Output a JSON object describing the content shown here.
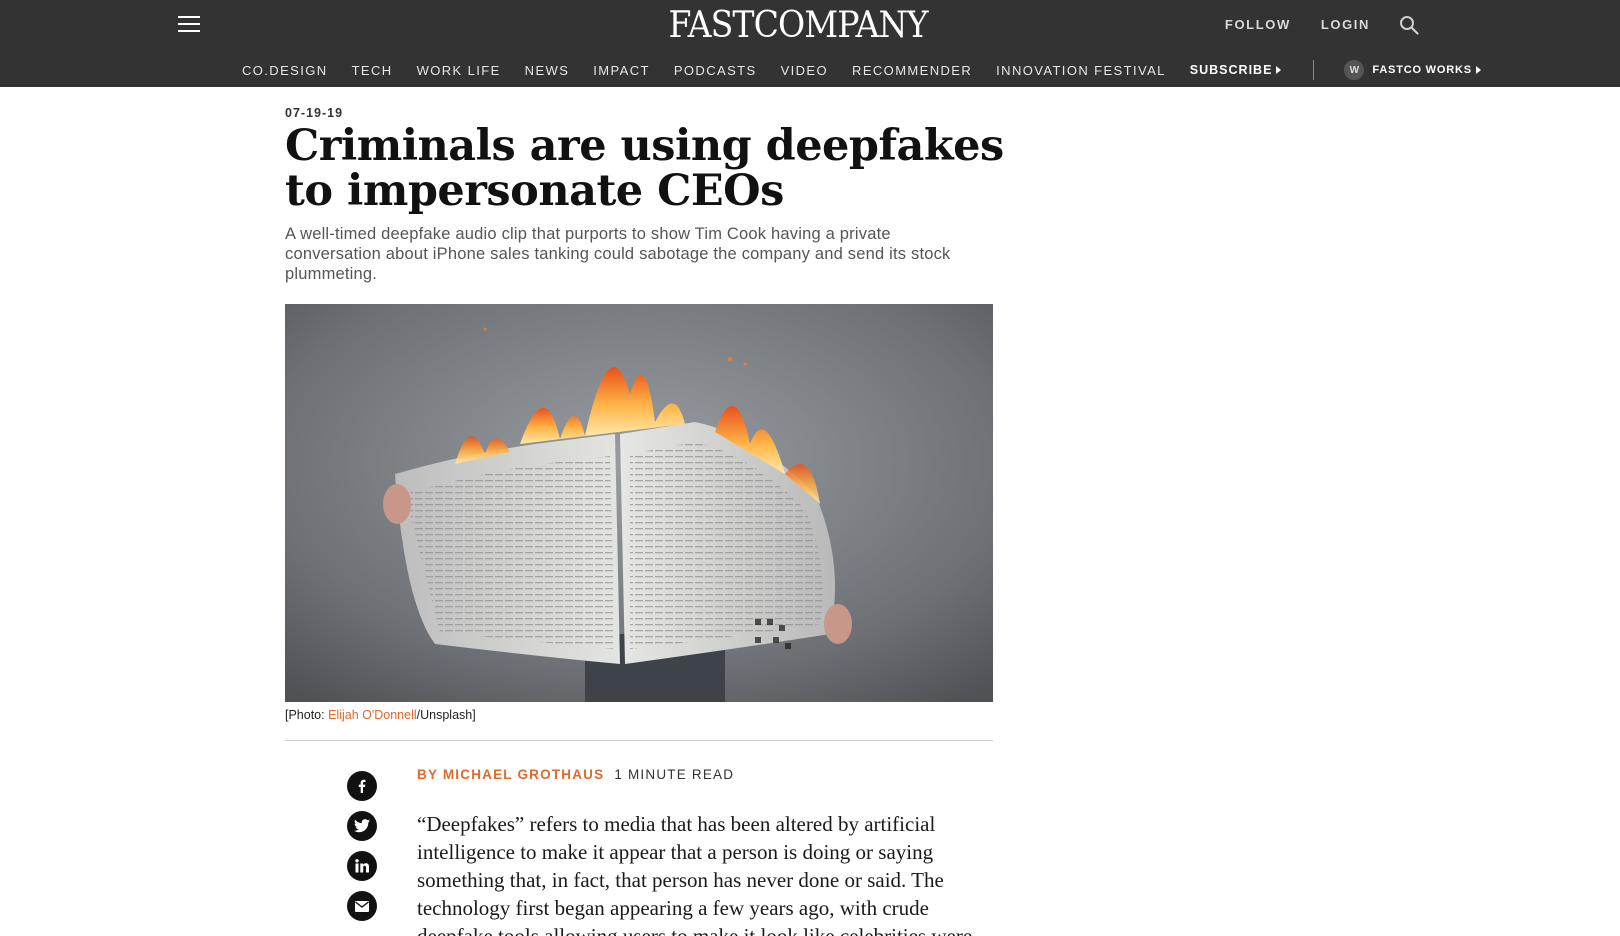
{
  "header": {
    "logo_text": "FASTCOMPANY",
    "top_links": [
      "FOLLOW",
      "LOGIN"
    ],
    "nav_items": [
      "CO.DESIGN",
      "TECH",
      "WORK LIFE",
      "NEWS",
      "IMPACT",
      "PODCASTS",
      "VIDEO",
      "RECOMMENDER",
      "INNOVATION FESTIVAL"
    ],
    "subscribe_label": "SUBSCRIBE",
    "works_badge": "W",
    "works_label": "FASTCO WORKS"
  },
  "article": {
    "date": "07-19-19",
    "headline": "Criminals are using deepfakes to impersonate CEOs",
    "dek": "A well-timed deepfake audio clip that purports to show Tim Cook having a private conversation about iPhone sales tanking could sabotage the company and send its stock plummeting.",
    "caption_prefix": "[Photo: ",
    "caption_credit": "Elijah O'Donnell",
    "caption_suffix": "/Unsplash]",
    "byline": "BY MICHAEL GROTHAUS",
    "read_time": "1 MINUTE READ",
    "body": "“Deepfakes” refers to media that has been altered by artificial intelligence to make it appear that a person is doing or saying something that, in fact, that person has never done or said. The technology first began appearing a few years ago, with crude deepfake tools allowing users to make it look like celebrities were"
  },
  "share_icons": [
    "facebook-icon",
    "twitter-icon",
    "linkedin-icon",
    "email-icon"
  ],
  "colors": {
    "header_bg": "#333333",
    "accent": "#e0692c"
  }
}
